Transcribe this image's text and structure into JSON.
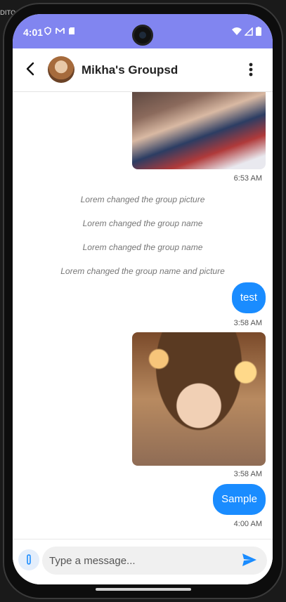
{
  "status_bar": {
    "time": "4:01",
    "background": "#8185f0"
  },
  "header": {
    "title": "Mikha's Groupsd"
  },
  "messages": {
    "photo1_time": "6:53 AM",
    "system_1": "Lorem changed the group picture",
    "system_2": "Lorem changed the group name",
    "system_3": "Lorem changed the group name",
    "system_4": "Lorem changed the group name and picture",
    "bubble_1": "test",
    "bubble_1_time": "3:58 AM",
    "photo2_time": "3:58 AM",
    "bubble_2": "Sample",
    "bubble_2_time": "4:00 AM"
  },
  "composer": {
    "placeholder": "Type a message..."
  },
  "colors": {
    "accent": "#1a8cff",
    "statusbar": "#8185f0"
  },
  "side_label": "DITO"
}
